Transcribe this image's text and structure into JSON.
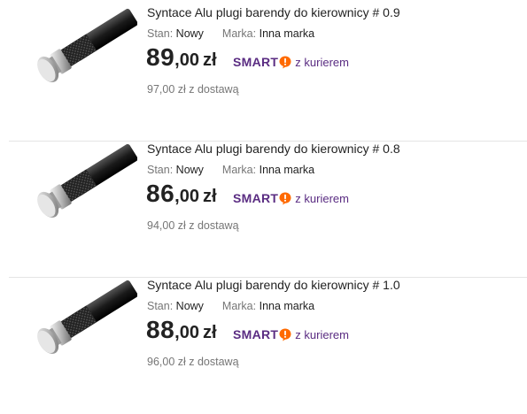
{
  "listings": [
    {
      "title": "Syntace Alu plugi barendy do kierownicy # 0.9",
      "condition_label": "Stan:",
      "condition_value": "Nowy",
      "brand_label": "Marka:",
      "brand_value": "Inna marka",
      "price_int": "89",
      "price_dec": ",00",
      "currency": "zł",
      "smart_word": "SMART",
      "smart_courier": "z kurierem",
      "delivery": "97,00 zł z dostawą"
    },
    {
      "title": "Syntace Alu plugi barendy do kierownicy # 0.8",
      "condition_label": "Stan:",
      "condition_value": "Nowy",
      "brand_label": "Marka:",
      "brand_value": "Inna marka",
      "price_int": "86",
      "price_dec": ",00",
      "currency": "zł",
      "smart_word": "SMART",
      "smart_courier": "z kurierem",
      "delivery": "94,00 zł z dostawą"
    },
    {
      "title": "Syntace Alu plugi barendy do kierownicy # 1.0",
      "condition_label": "Stan:",
      "condition_value": "Nowy",
      "brand_label": "Marka:",
      "brand_value": "Inna marka",
      "price_int": "88",
      "price_dec": ",00",
      "currency": "zł",
      "smart_word": "SMART",
      "smart_courier": "z kurierem",
      "delivery": "96,00 zł z dostawą"
    }
  ],
  "colors": {
    "smart_purple": "#5a2c82",
    "smart_orange": "#ff6a00",
    "muted_text": "#767676"
  },
  "icons": {
    "thumbnail": "handlebar-plug-image",
    "smart_badge": "smart-exclamation-icon"
  }
}
